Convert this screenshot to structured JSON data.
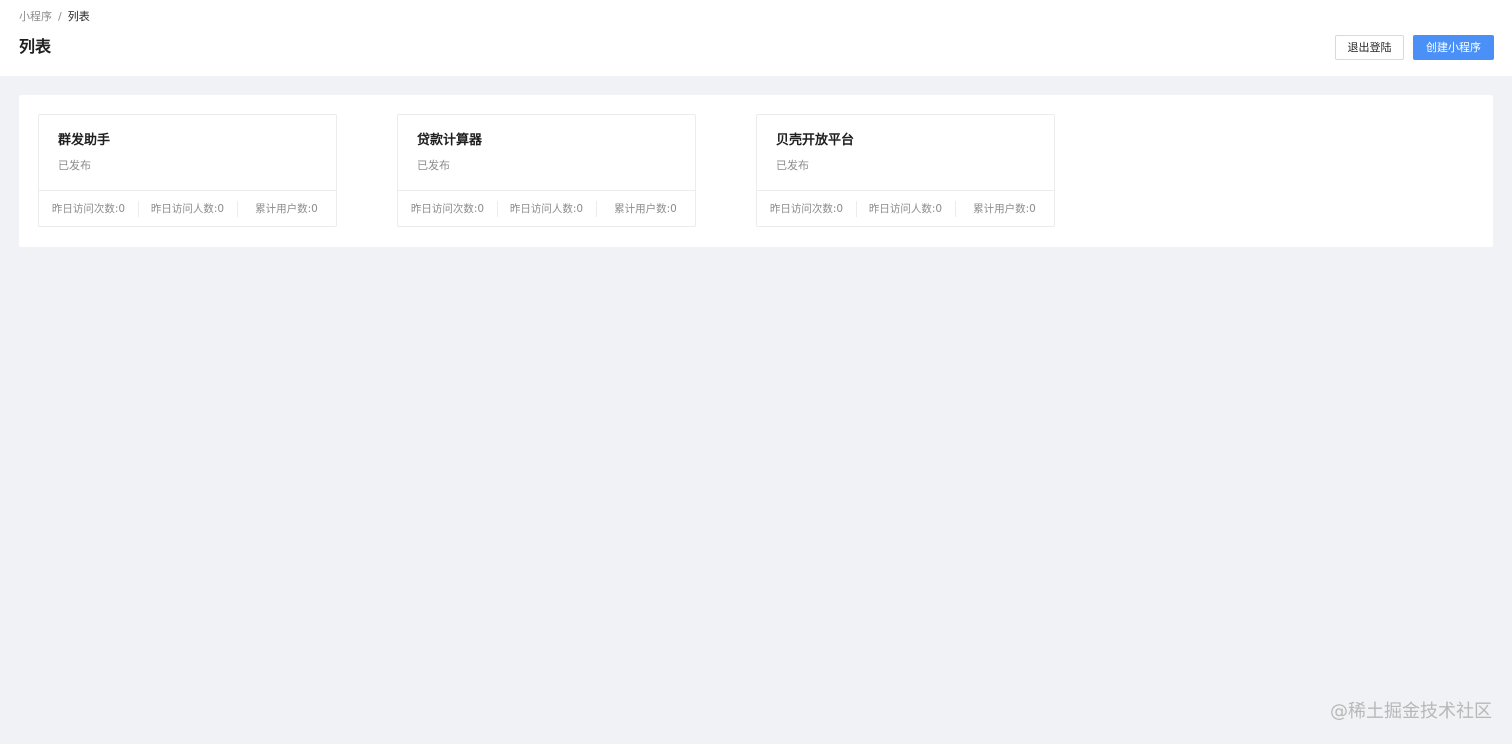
{
  "breadcrumb": {
    "items": [
      "小程序",
      "列表"
    ],
    "separator": "/"
  },
  "header": {
    "title": "列表",
    "logout_label": "退出登陆",
    "create_label": "创建小程序"
  },
  "cards": [
    {
      "name": "群发助手",
      "status": "已发布",
      "stats": [
        "昨日访问次数:0",
        "昨日访问人数:0",
        "累计用户数:0"
      ]
    },
    {
      "name": "贷款计算器",
      "status": "已发布",
      "stats": [
        "昨日访问次数:0",
        "昨日访问人数:0",
        "累计用户数:0"
      ]
    },
    {
      "name": "贝壳开放平台",
      "status": "已发布",
      "stats": [
        "昨日访问次数:0",
        "昨日访问人数:0",
        "累计用户数:0"
      ]
    }
  ],
  "watermark": "@稀土掘金技术社区",
  "colors": {
    "primary": "#4a90f7",
    "background": "#f0f2f5",
    "muted_text": "#8c8c8c"
  }
}
